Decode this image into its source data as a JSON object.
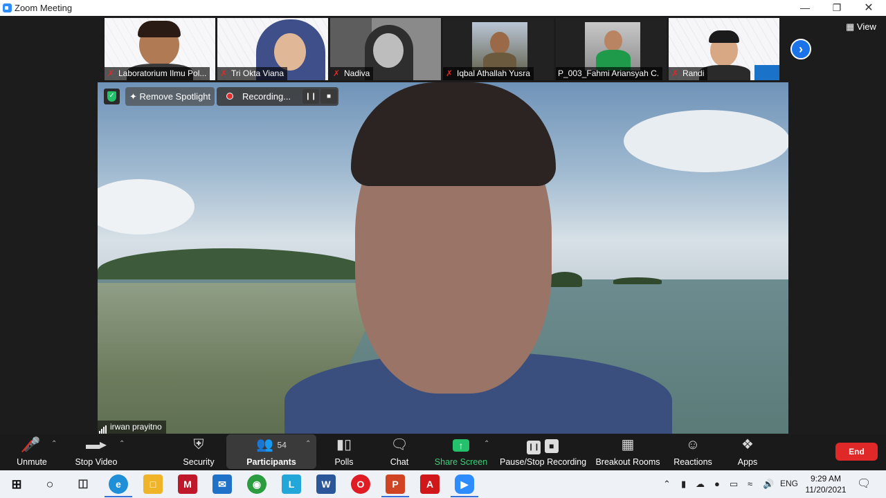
{
  "window": {
    "title": "Zoom Meeting"
  },
  "gallery": {
    "participants": [
      {
        "name": "Laboratorium Ilmu Pol..."
      },
      {
        "name": "Tri Okta Viana"
      },
      {
        "name": "Nadiva"
      },
      {
        "name": "Iqbal Athallah Yusra"
      },
      {
        "name": "P_003_Fahmi Ariansyah C."
      },
      {
        "name": "Randi"
      }
    ],
    "view_label": "View"
  },
  "main": {
    "remove_spotlight": "Remove Spotlight",
    "recording_label": "Recording...",
    "speaker_name": "irwan prayitno"
  },
  "toolbar": {
    "unmute": "Unmute",
    "stop_video": "Stop Video",
    "security": "Security",
    "participants": "Participants",
    "participants_count": "54",
    "polls": "Polls",
    "chat": "Chat",
    "share_screen": "Share Screen",
    "pause_stop_recording": "Pause/Stop Recording",
    "breakout_rooms": "Breakout Rooms",
    "reactions": "Reactions",
    "apps": "Apps",
    "end": "End"
  },
  "taskbar": {
    "time": "9:29 AM",
    "date": "11/20/2021",
    "language": "ENG"
  },
  "colors": {
    "accent": "#2d8cff",
    "end": "#e02828",
    "share": "#23c16b",
    "muted": "#e02828"
  }
}
